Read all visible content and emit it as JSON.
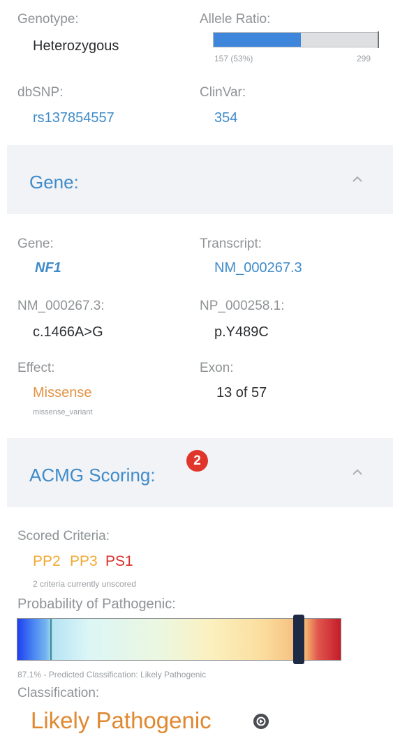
{
  "variant": {
    "genotype_label": "Genotype:",
    "genotype_value": "Heterozygous",
    "allele_ratio_label": "Allele Ratio:",
    "allele_ratio_left": "157 (53%)",
    "allele_ratio_right": "299",
    "allele_ratio_fraction": 0.53,
    "dbsnp_label": "dbSNP:",
    "dbsnp_value": "rs137854557",
    "clinvar_label": "ClinVar:",
    "clinvar_value": "354"
  },
  "gene_section": {
    "title": "Gene:",
    "gene_label": "Gene:",
    "gene_value": "NF1",
    "transcript_label": "Transcript:",
    "transcript_value": "NM_000267.3",
    "cdna_label": "NM_000267.3:",
    "cdna_value": "c.1466A>G",
    "protein_label": "NP_000258.1:",
    "protein_value": "p.Y489C",
    "effect_label": "Effect:",
    "effect_value": "Missense",
    "effect_sub": "missense_variant",
    "exon_label": "Exon:",
    "exon_value": "13 of 57"
  },
  "acmg_section": {
    "title": "ACMG Scoring:",
    "badge_count": "2",
    "scored_label": "Scored Criteria:",
    "criteria": [
      {
        "code": "PP2",
        "color": "#f0a934"
      },
      {
        "code": "PP3",
        "color": "#f0a934"
      },
      {
        "code": "PS1",
        "color": "#d9302b"
      }
    ],
    "unscored_note": "2 criteria currently unscored",
    "probability_label": "Probability of Pathogenic:",
    "probability_fraction": 0.871,
    "probability_caption": "87.1% - Predicted Classification: Likely Pathogenic",
    "classification_label": "Classification:",
    "classification_value": "Likely Pathogenic"
  },
  "colors": {
    "link": "#3f8bc9",
    "section_bg": "#f1f3f6",
    "accent_orange": "#e08830",
    "badge_red": "#e0352b"
  },
  "icons": {
    "chevron": "chevron-up-icon",
    "info": "info-arrow-icon"
  }
}
